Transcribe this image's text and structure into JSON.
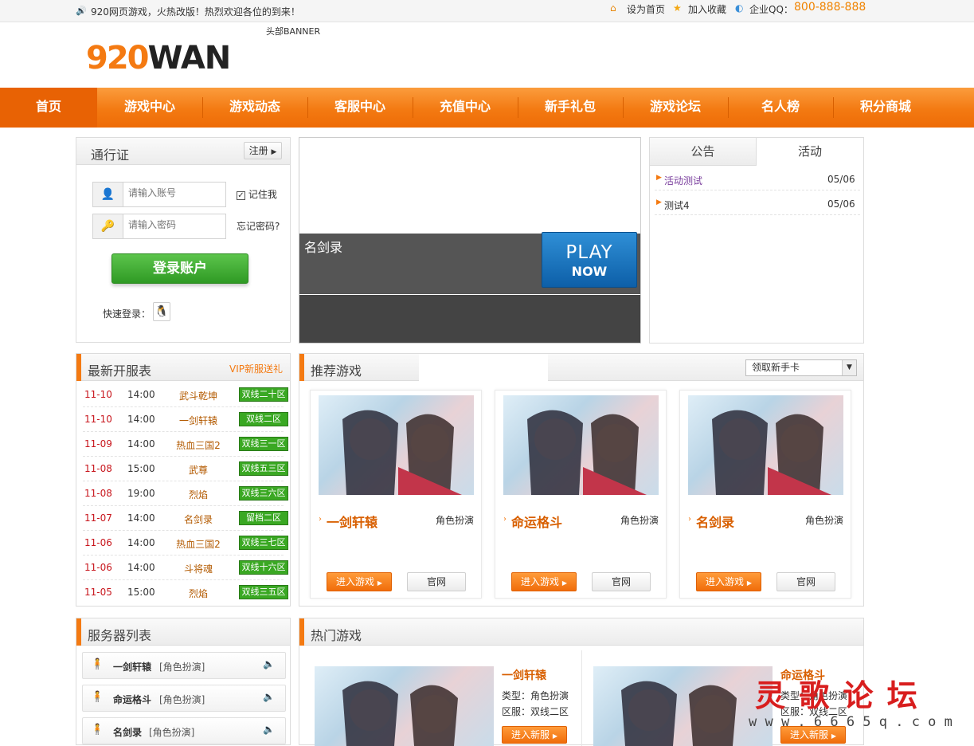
{
  "topbar": {
    "welcome": "920网页游戏，火热改版！热烈欢迎各位的到来！",
    "set_home": "设为首页",
    "favorite": "加入收藏",
    "qq_label": "企业QQ：",
    "qq_number": "800-888-888"
  },
  "header": {
    "logo_num": "920",
    "logo_text": "WAN",
    "banner_label": "头部BANNER"
  },
  "nav": [
    "首页",
    "游戏中心",
    "游戏动态",
    "客服中心",
    "充值中心",
    "新手礼包",
    "游戏论坛",
    "名人榜",
    "积分商城"
  ],
  "login": {
    "title": "通行证",
    "register": "注册",
    "account_placeholder": "请输入账号",
    "password_placeholder": "请输入密码",
    "remember": "记住我",
    "forgot": "忘记密码?",
    "submit": "登录账户",
    "quick_login": "快速登录："
  },
  "slide": {
    "caption": "名剑录",
    "play": "PLAY",
    "now": "NOW"
  },
  "notice": {
    "tabs": [
      "公告",
      "活动"
    ],
    "items": [
      {
        "title": "活动测试",
        "date": "05/06"
      },
      {
        "title": "测试4",
        "date": "05/06"
      }
    ]
  },
  "servers": {
    "title": "最新开服表",
    "vip": "VIP新服送礼",
    "rows": [
      {
        "date": "11-10",
        "time": "14:00",
        "game": "武斗乾坤",
        "zone": "双线二十区"
      },
      {
        "date": "11-10",
        "time": "14:00",
        "game": "一剑轩辕",
        "zone": "双线二区"
      },
      {
        "date": "11-09",
        "time": "14:00",
        "game": "热血三国2",
        "zone": "双线三一区"
      },
      {
        "date": "11-08",
        "time": "15:00",
        "game": "武尊",
        "zone": "双线五三区"
      },
      {
        "date": "11-08",
        "time": "19:00",
        "game": "烈焰",
        "zone": "双线三六区"
      },
      {
        "date": "11-07",
        "time": "14:00",
        "game": "名剑录",
        "zone": "留档二区"
      },
      {
        "date": "11-06",
        "time": "14:00",
        "game": "热血三国2",
        "zone": "双线三七区"
      },
      {
        "date": "11-06",
        "time": "14:00",
        "game": "斗将魂",
        "zone": "双线十六区"
      },
      {
        "date": "11-05",
        "time": "15:00",
        "game": "烈焰",
        "zone": "双线三五区"
      }
    ]
  },
  "recommend": {
    "title": "推荐游戏",
    "select": "领取新手卡",
    "games": [
      {
        "name": "一剑轩辕",
        "type": "角色扮演",
        "enter": "进入游戏",
        "site": "官网"
      },
      {
        "name": "命运格斗",
        "type": "角色扮演",
        "enter": "进入游戏",
        "site": "官网"
      },
      {
        "name": "名剑录",
        "type": "角色扮演",
        "enter": "进入游戏",
        "site": "官网"
      }
    ]
  },
  "serverlist": {
    "title": "服务器列表",
    "items": [
      {
        "name": "一剑轩辕",
        "type": "[角色扮演]"
      },
      {
        "name": "命运格斗",
        "type": "[角色扮演]"
      },
      {
        "name": "名剑录",
        "type": "[角色扮演]"
      }
    ]
  },
  "hot": {
    "title": "热门游戏",
    "games": [
      {
        "name": "一剑轩辕",
        "type": "类型：角色扮演",
        "zone": "区服：双线二区",
        "enter": "进入新服"
      },
      {
        "name": "命运格斗",
        "type": "类型：角色扮演",
        "zone": "区服：双线二区",
        "enter": "进入新服"
      }
    ]
  },
  "watermark": {
    "title": "灵 歌 论 坛",
    "url": "w w w . 6 6 6 5 q . c o m"
  },
  "colors": {
    "accent": "#f47a12",
    "nav_bg": "#f37a12",
    "badge": "#3aa823",
    "date_red": "#c8161d"
  }
}
